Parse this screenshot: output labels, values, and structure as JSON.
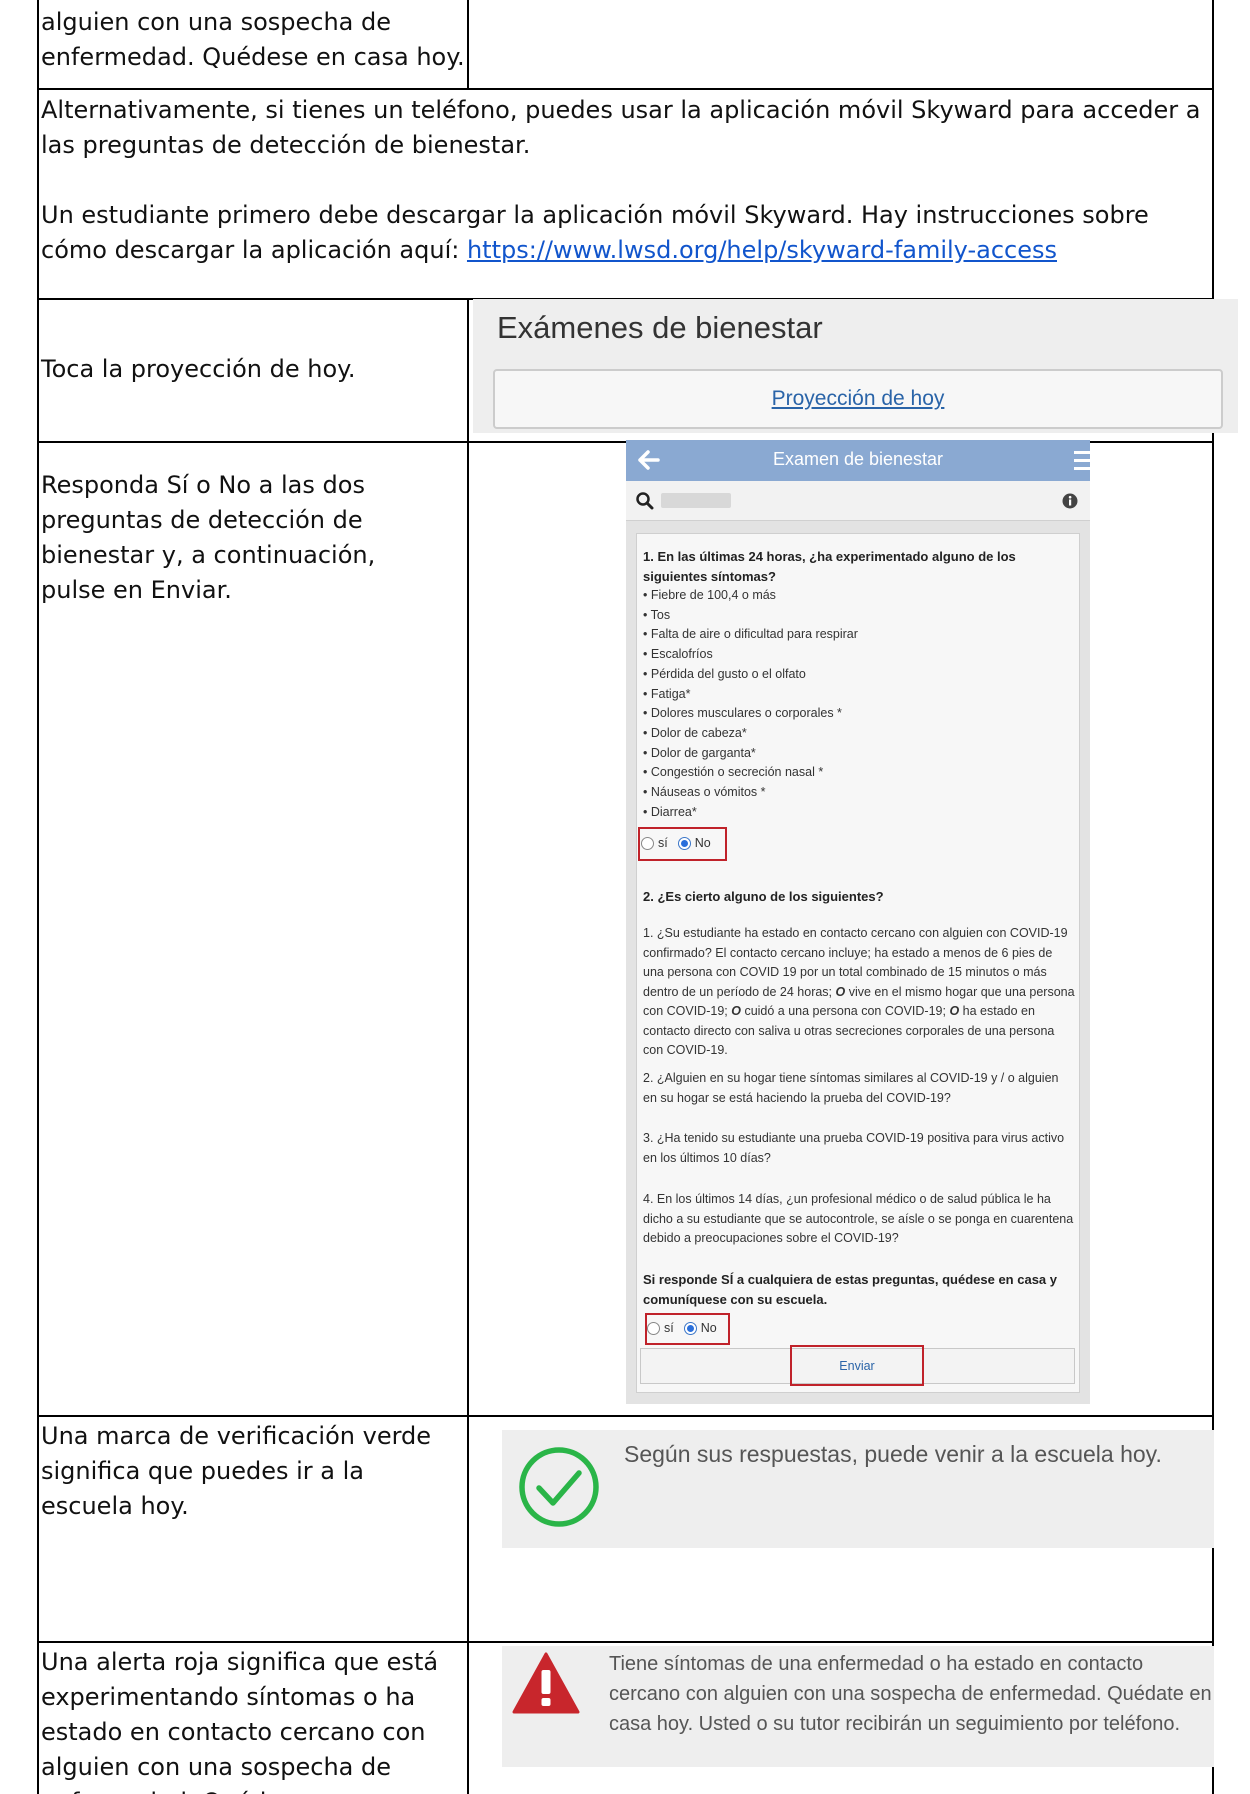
{
  "row_top": {
    "text_line1": "alguien con una sospecha de",
    "text_line2": "enfermedad.  Quédese en casa hoy."
  },
  "row_app": {
    "para1": "Alternativamente, si tienes un teléfono, puedes usar la aplicación móvil Skyward para acceder a las preguntas de detección de bienestar.",
    "para2_text": "Un estudiante primero debe descargar la aplicación móvil Skyward.  Hay instrucciones sobre cómo descargar la aplicación aquí: ",
    "para2_link": "https://www.lwsd.org/help/skyward-family-access"
  },
  "row_tap": {
    "instruction": "Toca la proyección de hoy.",
    "screen_title": "Exámenes de bienestar",
    "screen_button": "Proyección de hoy"
  },
  "row_answer": {
    "instruction": "Responda Sí o No a las dos preguntas de detección de bienestar y, a continuación, pulse en Enviar.",
    "phone": {
      "header_title": "Examen de bienestar",
      "icons": {
        "back": "arrow-left-icon",
        "menu": "hamburger-menu-icon",
        "search": "search-icon",
        "info": "info-icon"
      },
      "q1_title": "1. En las últimas 24 horas, ¿ha experimentado alguno de los siguientes síntomas?",
      "symptoms": [
        "Fiebre de 100,4 o más",
        "Tos",
        "Falta de aire o dificultad para respirar",
        "Escalofríos",
        "Pérdida del gusto o el olfato",
        "Fatiga*",
        "Dolores musculares o corporales *",
        "Dolor de cabeza*",
        "Dolor de garganta*",
        "Congestión o secreción nasal *",
        "Náuseas o vómitos *",
        "Diarrea*"
      ],
      "option_yes": "sí",
      "option_no": "No",
      "q1_selected": "No",
      "q2_title": "2. ¿Es cierto alguno de los siguientes?",
      "q2_item1_a": "1. ¿Su estudiante ha estado en contacto cercano con alguien con COVID-19 confirmado? El contacto cercano incluye; ha estado a menos de 6 pies de una persona con COVID 19 por un total combinado de 15 minutos o más dentro de un período de 24 horas; ",
      "q2_item1_o1": "O",
      "q2_item1_b": " vive en el mismo hogar que una persona con COVID-19; ",
      "q2_item1_o2": "O",
      "q2_item1_c": " cuidó a una persona con COVID-19; ",
      "q2_item1_o3": "O",
      "q2_item1_d": " ha estado en contacto directo con saliva u otras secreciones corporales de una persona con COVID-19.",
      "q2_item2": "2. ¿Alguien en su hogar tiene síntomas similares al COVID-19 y / o alguien en su hogar se está haciendo la prueba del COVID-19?",
      "q2_item3": "3. ¿Ha tenido su estudiante una prueba COVID-19 positiva para virus activo en los últimos 10 días?",
      "q2_item4": "4. En los últimos 14 días, ¿un profesional médico o de salud pública le ha dicho a su estudiante que se autocontrole, se aísle o se ponga en cuarentena debido a preocupaciones sobre el COVID-19?",
      "q2_warning": "Si responde SÍ a cualquiera de estas preguntas, quédese en casa y comuníquese con su escuela.",
      "q2_selected": "No",
      "submit": "Enviar"
    }
  },
  "row_green": {
    "instruction": "Una marca de verificación verde significa que puedes ir a la escuela hoy.",
    "icon": "green-check-circle-icon",
    "color": "#2ab548",
    "message": "Según sus respuestas, puede venir a la escuela hoy."
  },
  "row_red": {
    "instruction": "Una alerta roja significa que está experimentando síntomas o ha estado en contacto cercano con alguien con una sospecha de enfermedad.  Quédese en casa hoy.",
    "icon": "red-alert-triangle-icon",
    "color": "#c8262c",
    "message": "Tiene síntomas de una enfermedad o ha estado en contacto cercano con alguien con una sospecha de enfermedad. Quédate en casa hoy. Usted o su tutor recibirán un seguimiento por teléfono."
  }
}
